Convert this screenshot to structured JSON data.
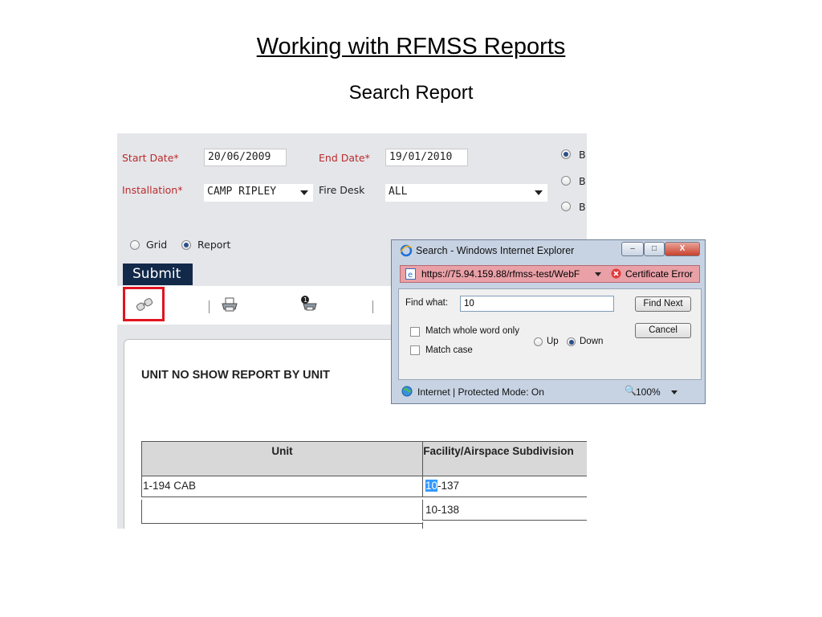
{
  "slide": {
    "title": "Working  with RFMSS Reports",
    "subtitle": "Search Report"
  },
  "form": {
    "start_date_label": "Start Date*",
    "start_date_value": "20/06/2009",
    "end_date_label": "End Date*",
    "end_date_value": "19/01/2010",
    "installation_label": "Installation*",
    "installation_value": "CAMP RIPLEY",
    "fire_desk_label": "Fire Desk",
    "fire_desk_value": "ALL",
    "right_options": [
      "B",
      "B",
      "B"
    ],
    "view_grid_label": "Grid",
    "view_report_label": "Report",
    "submit_label": "Submit"
  },
  "toolbar": {
    "icons": [
      "binoculars-icon",
      "printer-icon",
      "export-icon"
    ]
  },
  "report": {
    "title": "UNIT NO SHOW REPORT BY UNIT",
    "columns": [
      "Unit",
      "Facility/Airspace Subdivision"
    ],
    "rows": [
      {
        "unit": "1-194 CAB",
        "facility_match": "10",
        "facility_rest": "-137"
      },
      {
        "unit": "",
        "facility_match": "",
        "facility_rest": "10-138"
      }
    ]
  },
  "find_dialog": {
    "window_title": "Search - Windows Internet Explorer",
    "url": "https://75.94.159.88/rfmss-test/WebF",
    "certificate_error": "Certificate Error",
    "find_what_label": "Find what:",
    "find_what_value": "10",
    "find_next_label": "Find Next",
    "cancel_label": "Cancel",
    "match_whole_word": "Match whole word only",
    "match_case": "Match case",
    "direction_up": "Up",
    "direction_down": "Down",
    "status_zone": "Internet | Protected Mode: On",
    "zoom": "100%"
  },
  "colors": {
    "required_label": "#b92c2c",
    "submit_bg": "#12294a",
    "highlight_box": "#e0141f",
    "find_highlight": "#3399ff",
    "cert_error_bar": "#e9a0a7"
  }
}
